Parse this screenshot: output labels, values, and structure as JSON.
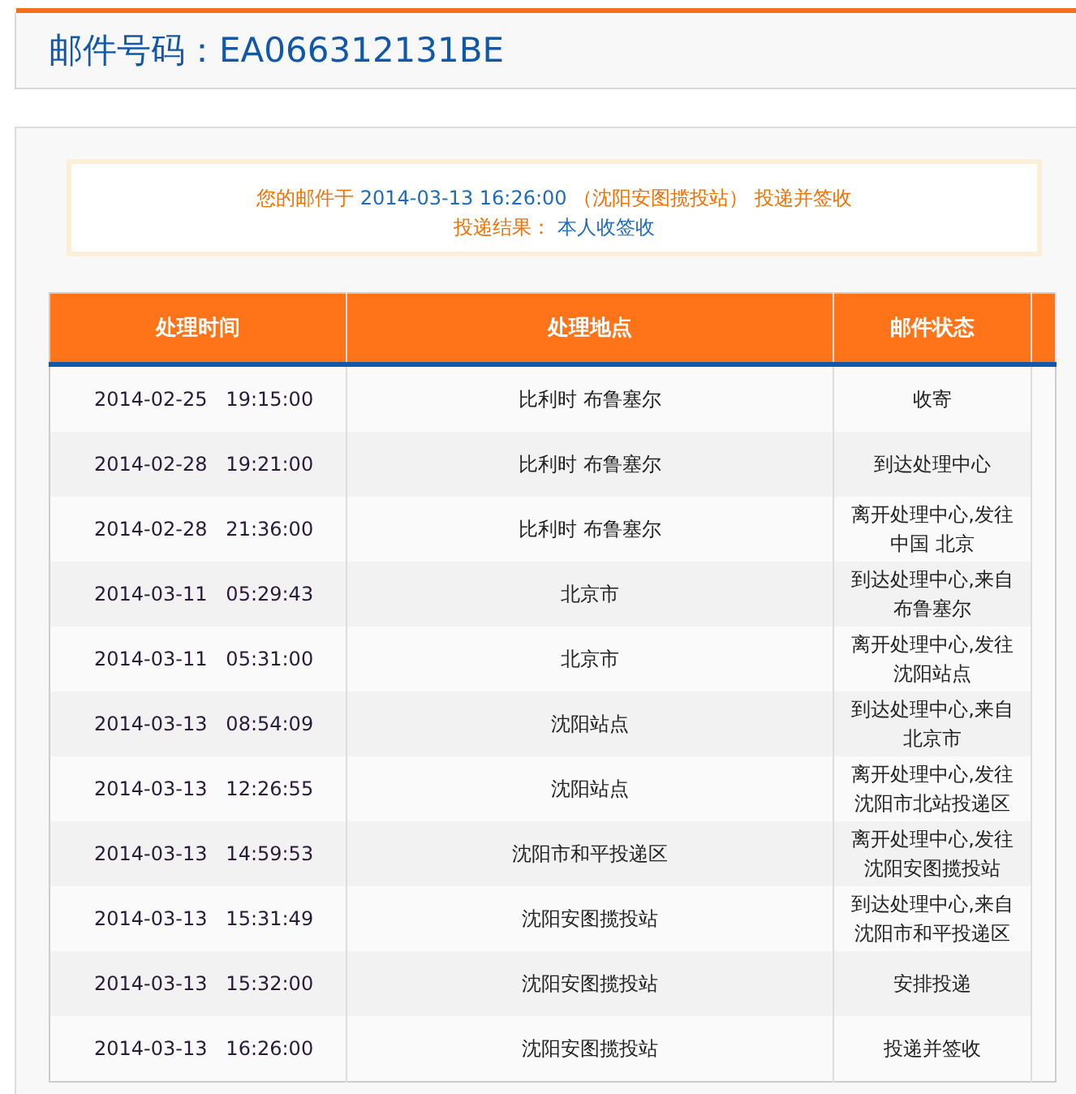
{
  "header": {
    "title": "邮件号码：EA066312131BE"
  },
  "notice": {
    "prefix": "您的邮件于",
    "time": "2014-03-13 16:26:00",
    "suffix": "（沈阳安图揽投站） 投递并签收",
    "result_label": "投递结果：",
    "result": "本人收签收"
  },
  "table": {
    "columns": [
      "处理时间",
      "处理地点",
      "邮件状态"
    ],
    "rows": [
      {
        "time": "2014-02-25   19:15:00",
        "place": "比利时 布鲁塞尔",
        "status": "收寄"
      },
      {
        "time": "2014-02-28   19:21:00",
        "place": "比利时 布鲁塞尔",
        "status": "到达处理中心"
      },
      {
        "time": "2014-02-28   21:36:00",
        "place": "比利时 布鲁塞尔",
        "status": "离开处理中心,发往中国 北京"
      },
      {
        "time": "2014-03-11   05:29:43",
        "place": "北京市",
        "status": "到达处理中心,来自布鲁塞尔"
      },
      {
        "time": "2014-03-11   05:31:00",
        "place": "北京市",
        "status": "离开处理中心,发往沈阳站点"
      },
      {
        "time": "2014-03-13   08:54:09",
        "place": "沈阳站点",
        "status": "到达处理中心,来自北京市"
      },
      {
        "time": "2014-03-13   12:26:55",
        "place": "沈阳站点",
        "status": "离开处理中心,发往沈阳市北站投递区"
      },
      {
        "time": "2014-03-13   14:59:53",
        "place": "沈阳市和平投递区",
        "status": "离开处理中心,发往沈阳安图揽投站"
      },
      {
        "time": "2014-03-13   15:31:49",
        "place": "沈阳安图揽投站",
        "status": "到达处理中心,来自沈阳市和平投递区"
      },
      {
        "time": "2014-03-13   15:32:00",
        "place": "沈阳安图揽投站",
        "status": "安排投递"
      },
      {
        "time": "2014-03-13   16:26:00",
        "place": "沈阳安图揽投站",
        "status": "投递并签收"
      }
    ]
  }
}
